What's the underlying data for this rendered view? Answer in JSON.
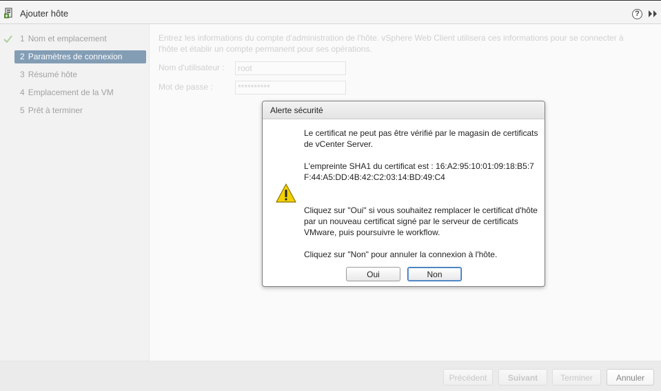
{
  "window": {
    "title": "Ajouter hôte",
    "help_glyph": "?",
    "icons": {
      "title": "host-add-icon",
      "help": "help-icon",
      "expand": "double-chevron-right-icon"
    }
  },
  "sidebar": {
    "steps": [
      {
        "number": "1",
        "label": "Nom et emplacement",
        "completed": true
      },
      {
        "number": "2",
        "label": "Paramètres de connexion",
        "active": true
      },
      {
        "number": "3",
        "label": "Résumé hôte"
      },
      {
        "number": "4",
        "label": "Emplacement de la VM"
      },
      {
        "number": "5",
        "label": "Prêt à terminer"
      }
    ],
    "completed_icon": "check-icon"
  },
  "content": {
    "intro": "Entrez les informations du compte d'administration de l'hôte. vSphere Web Client utilisera ces informations pour se connecter à l'hôte et établir un compte permanent pour ses opérations.",
    "username": {
      "label": "Nom d'utilisateur :",
      "value": "root"
    },
    "password": {
      "label": "Mot de passe :",
      "value": "**********"
    }
  },
  "footer": {
    "previous": "Précédent",
    "next": "Suivant",
    "finish": "Terminer",
    "cancel": "Annuler"
  },
  "dialog": {
    "title": "Alerte sécurité",
    "icon": "warning-icon",
    "paragraphs": [
      "Le certificat ne peut pas être vérifié par le magasin de certificats de vCenter Server.",
      "L'empreinte SHA1 du certificat est : 16:A2:95:10:01:09:18:B5:7F:44:A5:DD:4B:42:C2:03:14:BD:49:C4",
      "Cliquez sur \"Oui\" si vous souhaitez remplacer le certificat d'hôte par un nouveau certificat signé par le serveur de certificats VMware, puis poursuivre le workflow.",
      "Cliquez sur \"Non\" pour annuler la connexion à l'hôte."
    ],
    "yes": "Oui",
    "no": "Non"
  },
  "colors": {
    "active_step": "#1e4d78",
    "check": "#6aa84f",
    "warning": "#f2d100"
  }
}
